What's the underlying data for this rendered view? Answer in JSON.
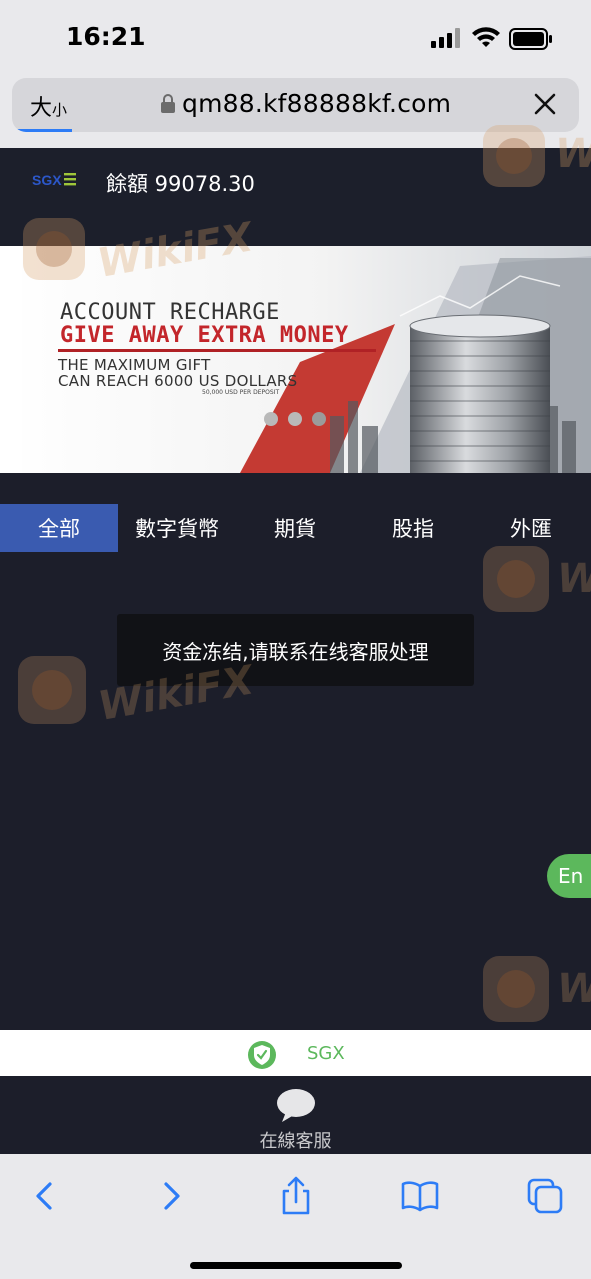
{
  "status_bar": {
    "time": "16:21"
  },
  "browser": {
    "text_size_label": "大",
    "text_size_small": "小",
    "url": "qm88.kf88888kf.com"
  },
  "header": {
    "logo": "SGX",
    "balance": "餘額 99078.30"
  },
  "banner": {
    "line1": "ACCOUNT RECHARGE",
    "line2": "GIVE AWAY EXTRA MONEY",
    "line3": "THE MAXIMUM GIFT",
    "line4": "CAN REACH 6000 US DOLLARS",
    "line5": "50,000 USD PER DEPOSIT",
    "colors": {
      "accent_red": "#c3262b"
    }
  },
  "tabs": [
    {
      "label": "全部",
      "active": true
    },
    {
      "label": "數字貨幣",
      "active": false
    },
    {
      "label": "期貨",
      "active": false
    },
    {
      "label": "股指",
      "active": false
    },
    {
      "label": "外匯",
      "active": false
    }
  ],
  "toast": {
    "message": "资金冻结,请联系在线客服处理"
  },
  "lang_button": {
    "label": "En"
  },
  "footer": {
    "brand": "SGX"
  },
  "service": {
    "label": "在線客服"
  },
  "watermark": {
    "text": "WikiFX"
  },
  "colors": {
    "background": "#1c1e2a",
    "tab_active": "#3a5bb0",
    "green": "#5cb85c",
    "ios_blue": "#2d7cf6"
  }
}
